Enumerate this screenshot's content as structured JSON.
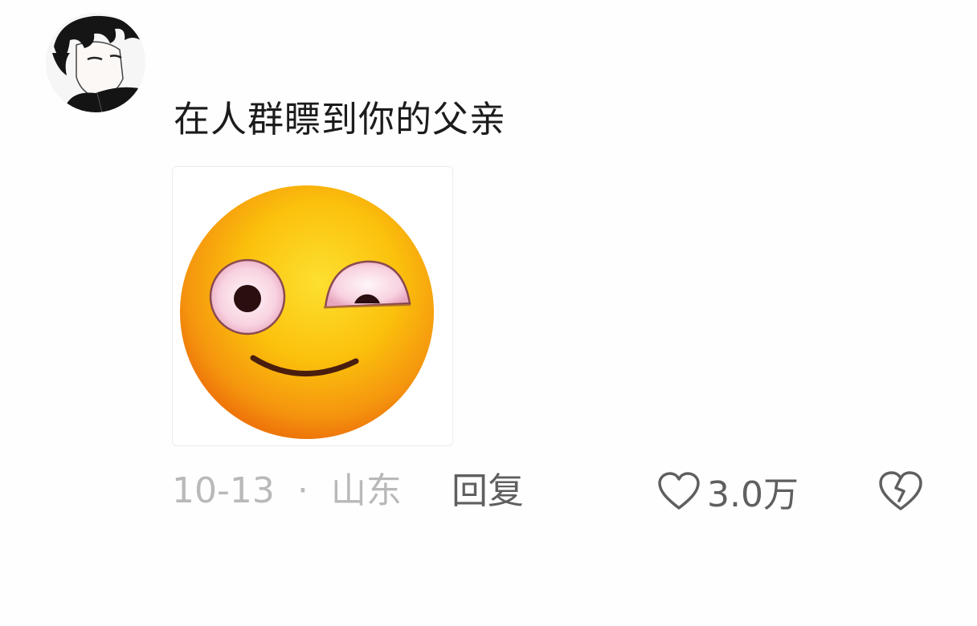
{
  "comment": {
    "text": "在人群瞟到你的父亲",
    "date": "10-13",
    "separator": "·",
    "location": "山东",
    "reply_label": "回复",
    "like_count": "3.0万"
  },
  "icons": {
    "avatar": "anime-avatar",
    "sticker": "side-eye-smile-emoji",
    "like": "heart-outline-icon",
    "dislike": "broken-heart-icon"
  },
  "colors": {
    "text_primary": "#1c1c1c",
    "text_meta": "#b9b9b9",
    "text_secondary": "#5f5f5f",
    "emoji_yellow": "#fbc10c",
    "emoji_orange": "#f07a0a"
  }
}
